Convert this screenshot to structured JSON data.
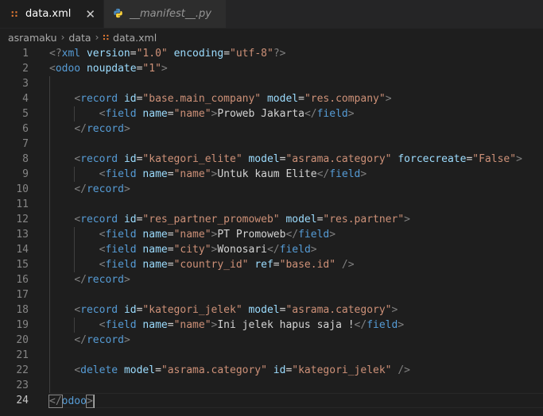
{
  "tabs": [
    {
      "label": "data.xml",
      "icon": "rss-icon",
      "active": true
    },
    {
      "label": "__manifest__.py",
      "icon": "python-icon",
      "active": false
    }
  ],
  "breadcrumb": [
    "asramaku",
    "data",
    "data.xml"
  ],
  "current_line": 24,
  "lines": [
    [
      [
        "br",
        "<?"
      ],
      [
        "tag",
        "xml"
      ],
      [
        "sp",
        " "
      ],
      [
        "attr",
        "version"
      ],
      [
        "eq",
        "="
      ],
      [
        "str",
        "\"1.0\""
      ],
      [
        "sp",
        " "
      ],
      [
        "attr",
        "encoding"
      ],
      [
        "eq",
        "="
      ],
      [
        "str",
        "\"utf-8\""
      ],
      [
        "br",
        "?>"
      ]
    ],
    [
      [
        "br",
        "<"
      ],
      [
        "tag",
        "odoo"
      ],
      [
        "sp",
        " "
      ],
      [
        "attr",
        "noupdate"
      ],
      [
        "eq",
        "="
      ],
      [
        "str",
        "\"1\""
      ],
      [
        "br",
        ">"
      ]
    ],
    [],
    [
      [
        "sp",
        "    "
      ],
      [
        "br",
        "<"
      ],
      [
        "tag",
        "record"
      ],
      [
        "sp",
        " "
      ],
      [
        "attr",
        "id"
      ],
      [
        "eq",
        "="
      ],
      [
        "str",
        "\"base.main_company\""
      ],
      [
        "sp",
        " "
      ],
      [
        "attr",
        "model"
      ],
      [
        "eq",
        "="
      ],
      [
        "str",
        "\"res.company\""
      ],
      [
        "br",
        ">"
      ]
    ],
    [
      [
        "sp",
        "        "
      ],
      [
        "br",
        "<"
      ],
      [
        "tag",
        "field"
      ],
      [
        "sp",
        " "
      ],
      [
        "attr",
        "name"
      ],
      [
        "eq",
        "="
      ],
      [
        "str",
        "\"name\""
      ],
      [
        "br",
        ">"
      ],
      [
        "txt",
        "Proweb Jakarta"
      ],
      [
        "br",
        "</"
      ],
      [
        "tag",
        "field"
      ],
      [
        "br",
        ">"
      ]
    ],
    [
      [
        "sp",
        "    "
      ],
      [
        "br",
        "</"
      ],
      [
        "tag",
        "record"
      ],
      [
        "br",
        ">"
      ]
    ],
    [],
    [
      [
        "sp",
        "    "
      ],
      [
        "br",
        "<"
      ],
      [
        "tag",
        "record"
      ],
      [
        "sp",
        " "
      ],
      [
        "attr",
        "id"
      ],
      [
        "eq",
        "="
      ],
      [
        "str",
        "\"kategori_elite\""
      ],
      [
        "sp",
        " "
      ],
      [
        "attr",
        "model"
      ],
      [
        "eq",
        "="
      ],
      [
        "str",
        "\"asrama.category\""
      ],
      [
        "sp",
        " "
      ],
      [
        "attr",
        "forcecreate"
      ],
      [
        "eq",
        "="
      ],
      [
        "str",
        "\"False\""
      ],
      [
        "br",
        ">"
      ]
    ],
    [
      [
        "sp",
        "        "
      ],
      [
        "br",
        "<"
      ],
      [
        "tag",
        "field"
      ],
      [
        "sp",
        " "
      ],
      [
        "attr",
        "name"
      ],
      [
        "eq",
        "="
      ],
      [
        "str",
        "\"name\""
      ],
      [
        "br",
        ">"
      ],
      [
        "txt",
        "Untuk kaum Elite"
      ],
      [
        "br",
        "</"
      ],
      [
        "tag",
        "field"
      ],
      [
        "br",
        ">"
      ]
    ],
    [
      [
        "sp",
        "    "
      ],
      [
        "br",
        "</"
      ],
      [
        "tag",
        "record"
      ],
      [
        "br",
        ">"
      ]
    ],
    [],
    [
      [
        "sp",
        "    "
      ],
      [
        "br",
        "<"
      ],
      [
        "tag",
        "record"
      ],
      [
        "sp",
        " "
      ],
      [
        "attr",
        "id"
      ],
      [
        "eq",
        "="
      ],
      [
        "str",
        "\"res_partner_promoweb\""
      ],
      [
        "sp",
        " "
      ],
      [
        "attr",
        "model"
      ],
      [
        "eq",
        "="
      ],
      [
        "str",
        "\"res.partner\""
      ],
      [
        "br",
        ">"
      ]
    ],
    [
      [
        "sp",
        "        "
      ],
      [
        "br",
        "<"
      ],
      [
        "tag",
        "field"
      ],
      [
        "sp",
        " "
      ],
      [
        "attr",
        "name"
      ],
      [
        "eq",
        "="
      ],
      [
        "str",
        "\"name\""
      ],
      [
        "br",
        ">"
      ],
      [
        "txt",
        "PT Promoweb"
      ],
      [
        "br",
        "</"
      ],
      [
        "tag",
        "field"
      ],
      [
        "br",
        ">"
      ]
    ],
    [
      [
        "sp",
        "        "
      ],
      [
        "br",
        "<"
      ],
      [
        "tag",
        "field"
      ],
      [
        "sp",
        " "
      ],
      [
        "attr",
        "name"
      ],
      [
        "eq",
        "="
      ],
      [
        "str",
        "\"city\""
      ],
      [
        "br",
        ">"
      ],
      [
        "txt",
        "Wonosari"
      ],
      [
        "br",
        "</"
      ],
      [
        "tag",
        "field"
      ],
      [
        "br",
        ">"
      ]
    ],
    [
      [
        "sp",
        "        "
      ],
      [
        "br",
        "<"
      ],
      [
        "tag",
        "field"
      ],
      [
        "sp",
        " "
      ],
      [
        "attr",
        "name"
      ],
      [
        "eq",
        "="
      ],
      [
        "str",
        "\"country_id\""
      ],
      [
        "sp",
        " "
      ],
      [
        "attr",
        "ref"
      ],
      [
        "eq",
        "="
      ],
      [
        "str",
        "\"base.id\""
      ],
      [
        "sp",
        " "
      ],
      [
        "br",
        "/>"
      ]
    ],
    [
      [
        "sp",
        "    "
      ],
      [
        "br",
        "</"
      ],
      [
        "tag",
        "record"
      ],
      [
        "br",
        ">"
      ]
    ],
    [],
    [
      [
        "sp",
        "    "
      ],
      [
        "br",
        "<"
      ],
      [
        "tag",
        "record"
      ],
      [
        "sp",
        " "
      ],
      [
        "attr",
        "id"
      ],
      [
        "eq",
        "="
      ],
      [
        "str",
        "\"kategori_jelek\""
      ],
      [
        "sp",
        " "
      ],
      [
        "attr",
        "model"
      ],
      [
        "eq",
        "="
      ],
      [
        "str",
        "\"asrama.category\""
      ],
      [
        "br",
        ">"
      ]
    ],
    [
      [
        "sp",
        "        "
      ],
      [
        "br",
        "<"
      ],
      [
        "tag",
        "field"
      ],
      [
        "sp",
        " "
      ],
      [
        "attr",
        "name"
      ],
      [
        "eq",
        "="
      ],
      [
        "str",
        "\"name\""
      ],
      [
        "br",
        ">"
      ],
      [
        "txt",
        "Ini jelek hapus saja !"
      ],
      [
        "br",
        "</"
      ],
      [
        "tag",
        "field"
      ],
      [
        "br",
        ">"
      ]
    ],
    [
      [
        "sp",
        "    "
      ],
      [
        "br",
        "</"
      ],
      [
        "tag",
        "record"
      ],
      [
        "br",
        ">"
      ]
    ],
    [],
    [
      [
        "sp",
        "    "
      ],
      [
        "br",
        "<"
      ],
      [
        "tag",
        "delete"
      ],
      [
        "sp",
        " "
      ],
      [
        "attr",
        "model"
      ],
      [
        "eq",
        "="
      ],
      [
        "str",
        "\"asrama.category\""
      ],
      [
        "sp",
        " "
      ],
      [
        "attr",
        "id"
      ],
      [
        "eq",
        "="
      ],
      [
        "str",
        "\"kategori_jelek\""
      ],
      [
        "sp",
        " "
      ],
      [
        "br",
        "/>"
      ]
    ],
    [],
    [
      [
        "brhl",
        "</"
      ],
      [
        "tag",
        "odoo"
      ],
      [
        "brhl",
        ">"
      ]
    ]
  ]
}
